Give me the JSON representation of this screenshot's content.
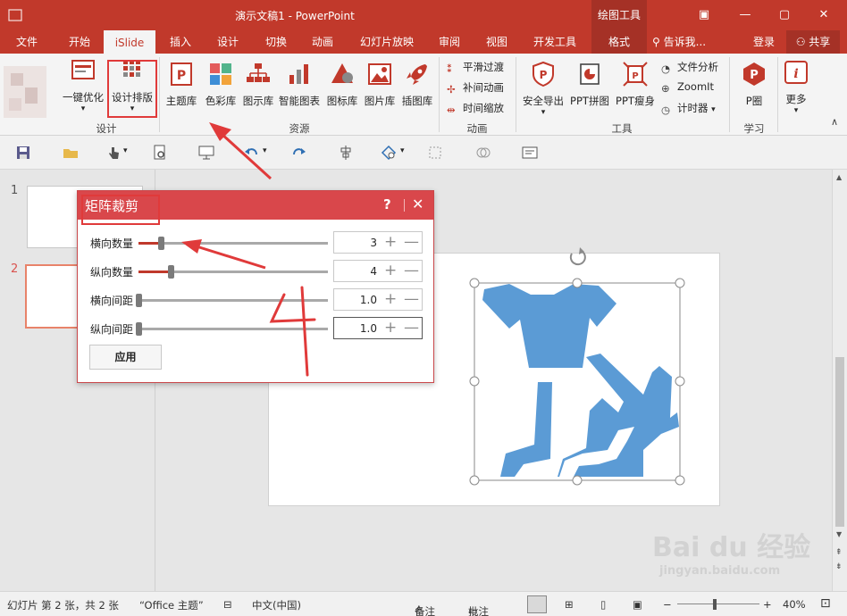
{
  "window": {
    "title": "演示文稿1 - PowerPoint",
    "context_tab": "绘图工具",
    "minimize": "—",
    "restore": "▢",
    "close": "✕"
  },
  "tabs": [
    "文件",
    "开始",
    "iSlide",
    "插入",
    "设计",
    "切换",
    "动画",
    "幻灯片放映",
    "审阅",
    "视图",
    "开发工具",
    "格式"
  ],
  "tell_me": "告诉我...",
  "signin": "登录",
  "share": "共享",
  "ribbon": {
    "design_group": {
      "optimize": "一键优化",
      "layout": "设计排版",
      "label": "设计"
    },
    "resources": {
      "items": [
        "主题库",
        "色彩库",
        "图示库",
        "智能图表",
        "图标库",
        "图片库",
        "插图库"
      ],
      "label": "资源"
    },
    "animation": {
      "items": [
        "平滑过渡",
        "补间动画",
        "时间缩放"
      ],
      "label": "动画"
    },
    "tools": {
      "big": [
        "安全导出",
        "PPT拼图",
        "PPT瘦身"
      ],
      "small": [
        "文件分析",
        "ZoomIt",
        "计时器"
      ],
      "label": "工具"
    },
    "learn": {
      "item": "P圈",
      "label": "学习"
    },
    "more": "更多"
  },
  "thumbnails": [
    "1",
    "2"
  ],
  "dialog": {
    "title": "矩阵裁剪",
    "help": "?",
    "close": "✕",
    "rows": [
      {
        "label": "横向数量",
        "value": "3",
        "level": 0.12
      },
      {
        "label": "纵向数量",
        "value": "4",
        "level": 0.17
      },
      {
        "label": "横向间距",
        "value": "1.0",
        "level": 0.0
      },
      {
        "label": "纵向间距",
        "value": "1.0",
        "level": 0.0
      }
    ],
    "apply": "应用"
  },
  "annotation": {
    "handwritten": "4"
  },
  "status": {
    "slide_info": "幻灯片 第 2 张，共 2 张",
    "theme": "“Office 主题”",
    "language": "中文(中国)",
    "notes": "备注",
    "comments": "批注",
    "zoom": "40%"
  },
  "watermark": {
    "text": "Bai du 经验",
    "url": "jingyan.baidu.com"
  },
  "colors": {
    "brand": "#c1392b",
    "dialog_head": "#d9474b",
    "shape": "#5b9bd5",
    "annotation": "#e03a3a"
  }
}
